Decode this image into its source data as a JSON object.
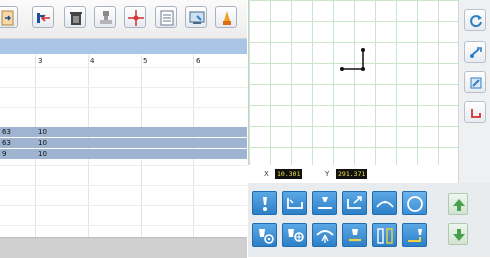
{
  "grid": {
    "columns": [
      "3",
      "4",
      "5",
      "6"
    ],
    "rows": [
      {
        "col1": "63",
        "col2": "10",
        "selected": true
      },
      {
        "col1": "63",
        "col2": "10",
        "selected": true
      },
      {
        "col1": "9",
        "col2": "10",
        "selected": true
      }
    ]
  },
  "coords": {
    "x_label": "X",
    "x_value": "10.301",
    "y_label": "Y",
    "y_value": "291.371"
  },
  "toolbar": {
    "icons": [
      "document-arrow-icon",
      "move-in-icon",
      "trash-icon",
      "stamp-icon",
      "crosshair-icon",
      "list-icon",
      "image-edit-icon",
      "warning-icon"
    ]
  },
  "palette": {
    "row1_icons": [
      "tool-point-icon",
      "path-corner-icon",
      "tool-line-icon",
      "move-corner-icon",
      "arc-icon",
      "circle-icon"
    ],
    "row2_icons": [
      "dispense-gear-icon",
      "dispense-gear-alt-icon",
      "spray-icon",
      "fill-icon",
      "split-icon",
      "corner-fill-icon"
    ]
  },
  "colors": {
    "selection": "#9fb4d1",
    "header_bar": "#a9c6e7",
    "grid_lines": "#c8e6c8",
    "palette_button": "#2d7fc7",
    "coord_text": "#f2e64a"
  }
}
